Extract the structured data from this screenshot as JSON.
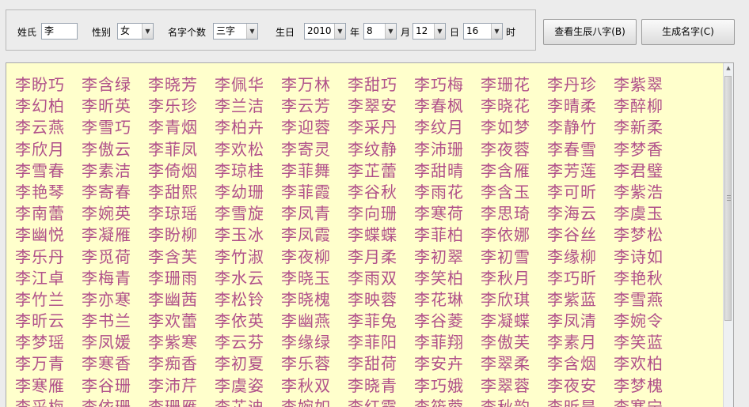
{
  "form": {
    "surname_label": "姓氏",
    "surname_value": "李",
    "gender_label": "性别",
    "gender_value": "女",
    "count_label": "名字个数",
    "count_value": "三字",
    "birthday_label": "生日",
    "year_value": "2010",
    "year_unit": "年",
    "month_value": "8",
    "month_unit": "月",
    "day_value": "12",
    "day_unit": "日",
    "hour_value": "16",
    "hour_unit": "时"
  },
  "buttons": {
    "bazi_label": "查看生辰八字(B)",
    "generate_label": "生成名字(C)"
  },
  "names": [
    "李盼巧",
    "李含绿",
    "李晓芳",
    "李佩华",
    "李万林",
    "李甜巧",
    "李巧梅",
    "李珊花",
    "李丹珍",
    "李紫翠",
    "李幻柏",
    "李昕英",
    "李乐珍",
    "李兰洁",
    "李云芳",
    "李翠安",
    "李春枫",
    "李晓花",
    "李晴柔",
    "李醉柳",
    "李云燕",
    "李雪巧",
    "李青烟",
    "李柏卉",
    "李迎蓉",
    "李采丹",
    "李纹月",
    "李如梦",
    "李静竹",
    "李新柔",
    "李欣月",
    "李傲云",
    "李菲凤",
    "李欢松",
    "李寄灵",
    "李纹静",
    "李沛珊",
    "李夜蓉",
    "李春雪",
    "李梦香",
    "李雪春",
    "李素洁",
    "李倚烟",
    "李琼桂",
    "李菲舞",
    "李芷蕾",
    "李甜晴",
    "李含雁",
    "李芳莲",
    "李君璧",
    "李艳琴",
    "李寄春",
    "李甜熙",
    "李幼珊",
    "李菲霞",
    "李谷秋",
    "李雨花",
    "李含玉",
    "李可昕",
    "李紫浩",
    "李南蕾",
    "李婉英",
    "李琼瑶",
    "李雪旋",
    "李凤青",
    "李向珊",
    "李寒荷",
    "李思琦",
    "李海云",
    "李虞玉",
    "李幽悦",
    "李凝雁",
    "李盼柳",
    "李玉冰",
    "李凤霞",
    "李蝶蝶",
    "李菲柏",
    "李依娜",
    "李谷丝",
    "李梦松",
    "李乐丹",
    "李觅荷",
    "李含芙",
    "李竹淑",
    "李夜柳",
    "李月柔",
    "李初翠",
    "李初雪",
    "李缘柳",
    "李诗如",
    "李江卓",
    "李梅青",
    "李珊雨",
    "李水云",
    "李晓玉",
    "李雨双",
    "李笑柏",
    "李秋月",
    "李巧昕",
    "李艳秋",
    "李竹兰",
    "李亦寒",
    "李幽茜",
    "李松铃",
    "李晓槐",
    "李映蓉",
    "李花琳",
    "李欣琪",
    "李紫蓝",
    "李雪燕",
    "李昕云",
    "李书兰",
    "李欢蕾",
    "李依英",
    "李幽燕",
    "李菲兔",
    "李谷菱",
    "李凝蝶",
    "李凤清",
    "李婉令",
    "李梦瑶",
    "李凤媛",
    "李紫寒",
    "李云芬",
    "李缘绿",
    "李菲阳",
    "李菲翔",
    "李傲芙",
    "李素月",
    "李笑蓝",
    "李万青",
    "李寒香",
    "李痴香",
    "李初夏",
    "李乐蓉",
    "李甜荷",
    "李安卉",
    "李翠柔",
    "李含烟",
    "李欢柏",
    "李寒雁",
    "李谷珊",
    "李沛芹",
    "李虞姿",
    "李秋双",
    "李晓青",
    "李巧娥",
    "李翠蓉",
    "李夜安",
    "李梦槐",
    "李采梅",
    "李依珊",
    "李珊雁",
    "李芷迪",
    "李婉如",
    "李红霞",
    "李筱蓉",
    "李秋韵",
    "李昕昊",
    "李寒宁"
  ]
}
